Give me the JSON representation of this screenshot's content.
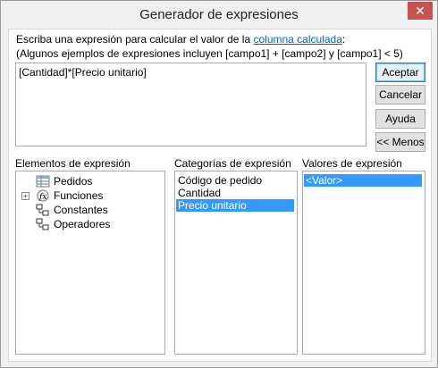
{
  "window": {
    "title": "Generador de expresiones",
    "close_label": "✕"
  },
  "instructions": {
    "line1_prefix": "Escriba una expresión para calcular el valor de la ",
    "line1_link": "columna calculada",
    "line1_suffix": ":",
    "line2": "(Algunos ejemplos de expresiones incluyen [campo1] + [campo2] y [campo1] < 5)"
  },
  "expression": {
    "value": "[Cantidad]*[Precio unitario]"
  },
  "buttons": {
    "accept": "Aceptar",
    "cancel": "Cancelar",
    "help": "Ayuda",
    "less": "<< Menos"
  },
  "elements": {
    "label": "Elementos de expresión",
    "items": [
      {
        "label": "Pedidos",
        "icon": "table-icon",
        "selected": true,
        "expandable": false
      },
      {
        "label": "Funciones",
        "icon": "function-icon",
        "selected": false,
        "expandable": true
      },
      {
        "label": "Constantes",
        "icon": "constants-icon",
        "selected": false,
        "expandable": false
      },
      {
        "label": "Operadores",
        "icon": "operators-icon",
        "selected": false,
        "expandable": false
      }
    ]
  },
  "categories": {
    "label": "Categorías de expresión",
    "items": [
      "Código de pedido",
      "Cantidad",
      "Precio unitario"
    ],
    "selected_index": 2
  },
  "values": {
    "label": "Valores de expresión",
    "items": [
      "<Valor>"
    ],
    "selected_index": 0
  },
  "colors": {
    "selection": "#3399ff",
    "link": "#0563c1",
    "close_button": "#c75050"
  }
}
